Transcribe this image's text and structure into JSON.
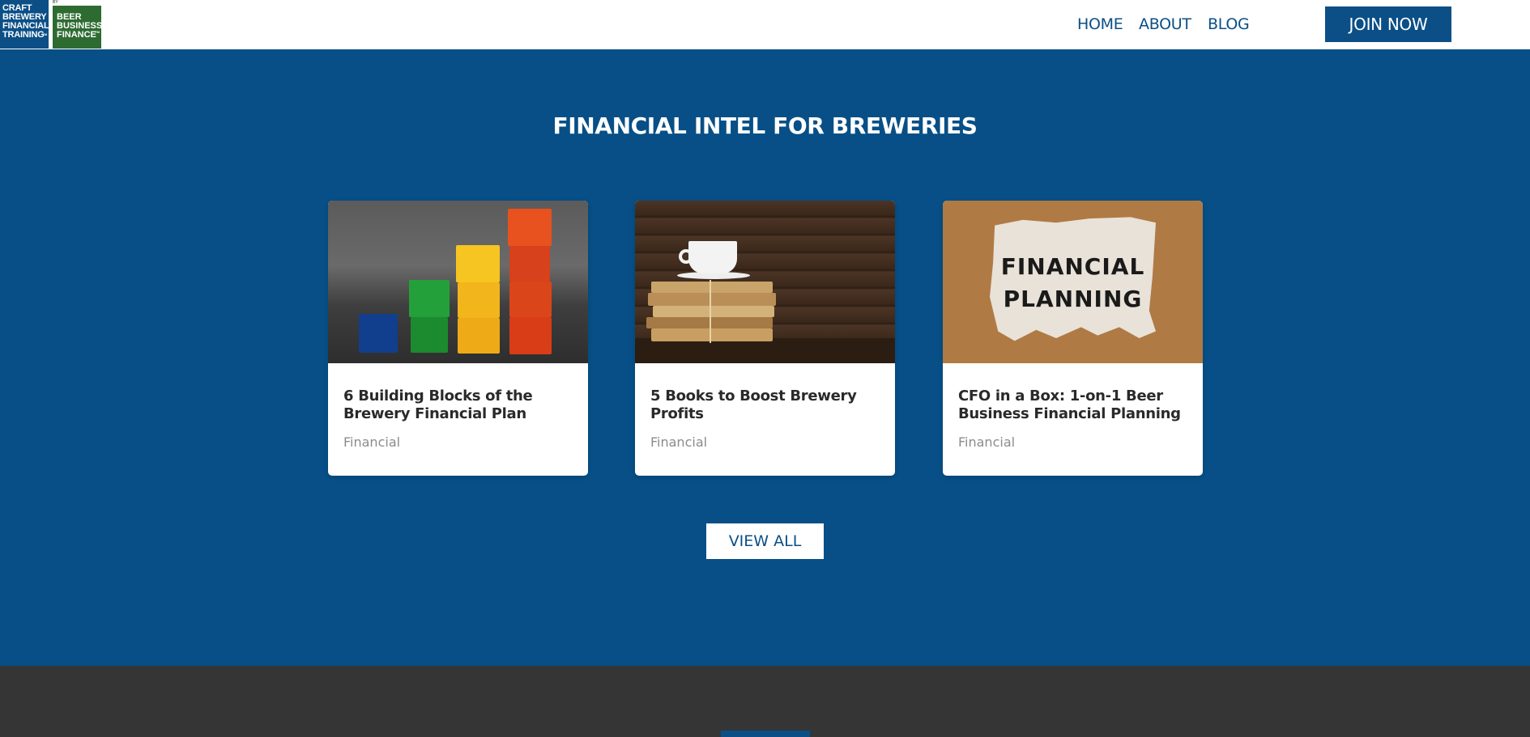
{
  "header": {
    "logo_primary": "CRAFT BREWERY FINANCIAL TRAINING",
    "logo_secondary_prefix": "BY",
    "logo_secondary": "BEER BUSINESS FINANCE",
    "nav": [
      {
        "label": "HOME"
      },
      {
        "label": "ABOUT"
      },
      {
        "label": "BLOG"
      }
    ],
    "cta_label": "JOIN NOW"
  },
  "section": {
    "title": "FINANCIAL INTEL FOR BREWERIES",
    "cards": [
      {
        "title": "6 Building Blocks of the Brewery Financial Plan",
        "category": "Financial",
        "image": "colored-blocks-chart-image"
      },
      {
        "title": "5 Books to Boost Brewery Profits",
        "category": "Financial",
        "image": "books-with-coffee-cup-image"
      },
      {
        "title": "CFO in a Box: 1-on-1 Beer Business Financial Planning",
        "category": "Financial",
        "image": "financial-planning-paper-image",
        "image_text_line1": "FINANCIAL",
        "image_text_line2": "PLANNING"
      }
    ],
    "view_all_label": "VIEW ALL"
  },
  "colors": {
    "brand_blue": "#0b4f86",
    "section_bg": "#074f86",
    "footer_bg": "#353535",
    "logo_green": "#2e6b31"
  }
}
